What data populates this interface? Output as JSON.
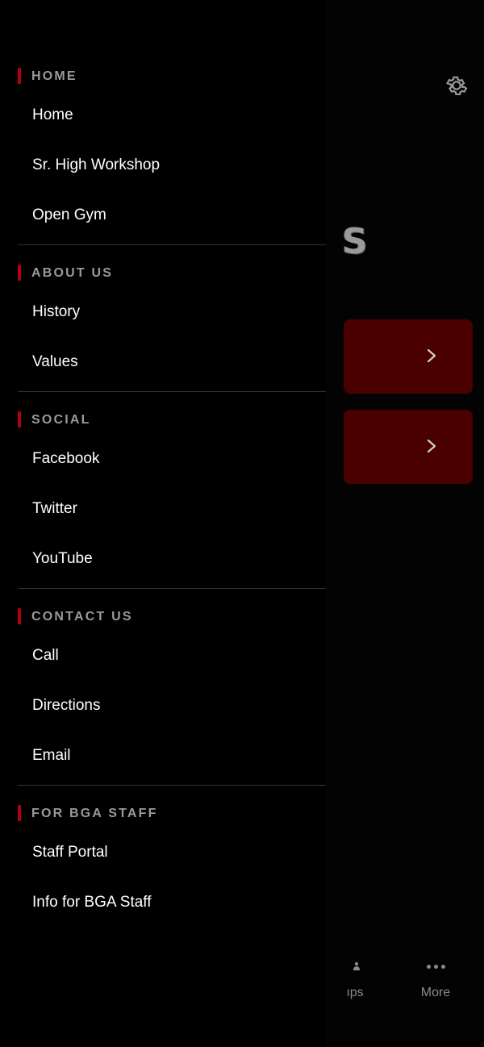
{
  "background": {
    "logo_fragment": "S",
    "tabs": [
      {
        "label": "ıps",
        "icon": "groups-icon"
      },
      {
        "label": "More",
        "icon": "more-dots-icon"
      }
    ]
  },
  "drawer": {
    "accent_color": "#b3000c",
    "sections": [
      {
        "title": "HOME",
        "items": [
          "Home",
          "Sr. High Workshop",
          "Open Gym"
        ]
      },
      {
        "title": "ABOUT US",
        "items": [
          "History",
          "Values"
        ]
      },
      {
        "title": "SOCIAL",
        "items": [
          "Facebook",
          "Twitter",
          "YouTube"
        ]
      },
      {
        "title": "CONTACT US",
        "items": [
          "Call",
          "Directions",
          "Email"
        ]
      },
      {
        "title": "FOR BGA STAFF",
        "items": [
          "Staff Portal",
          "Info for BGA Staff"
        ]
      }
    ]
  }
}
